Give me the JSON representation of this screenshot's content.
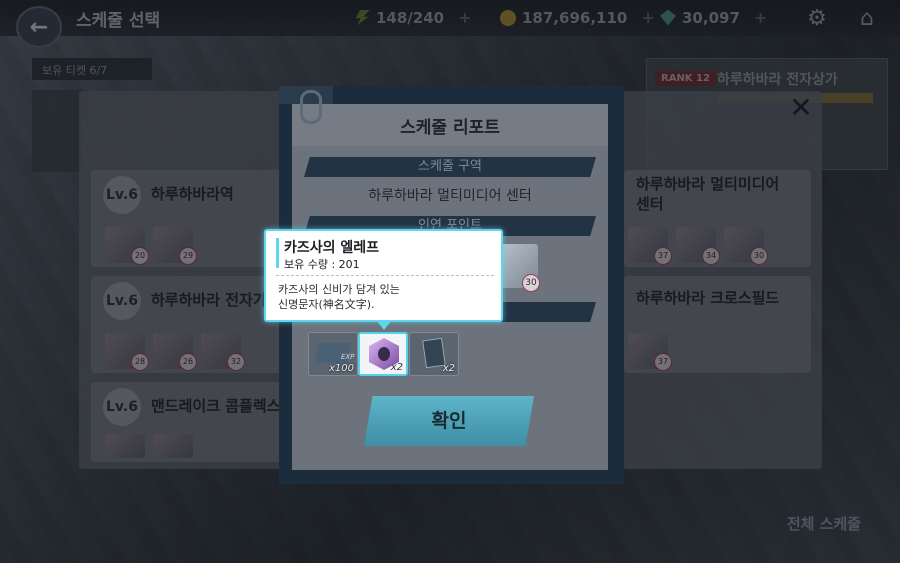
{
  "topbar": {
    "title": "스케줄 선택",
    "ap": "148/240",
    "gold": "187,696,110",
    "gems": "30,097"
  },
  "background": {
    "ticket_info": "보유 티켓 6/7",
    "rank_badge": "RANK 12",
    "rank_location": "하루하바라 전자상가",
    "locations_left": [
      {
        "lv": "Lv.6",
        "name": "하루하바라역",
        "char_levels": [
          "20",
          "29"
        ]
      },
      {
        "lv": "Lv.6",
        "name": "하루하바라 전자가",
        "char_levels": [
          "28",
          "26",
          "32"
        ]
      },
      {
        "lv": "Lv.6",
        "name": "맨드레이크 콤플렉스",
        "char_levels": []
      }
    ],
    "locations_right": [
      {
        "name": "하루하바라 멀티미디어 센터",
        "char_levels": [
          "37",
          "34",
          "30"
        ]
      },
      {
        "name": "하루하바라 크로스필드",
        "char_levels": [
          "37"
        ]
      }
    ],
    "all_schedule_label": "전체 스케줄"
  },
  "report": {
    "title": "스케줄 리포트",
    "area_label": "스케줄 구역",
    "area_value": "하루하바라 멀티미디어 센터",
    "bond_label": "인연 포인트",
    "char_level": "30",
    "rewards": [
      {
        "icon": "exp-report-icon",
        "qty": "x100"
      },
      {
        "icon": "eleph-crystal-icon",
        "qty": "x2"
      },
      {
        "icon": "artifact-card-icon",
        "qty": "x2"
      }
    ],
    "confirm_label": "확인"
  },
  "tooltip": {
    "name": "카즈사의 엘레프",
    "count": "보유 수량 : 201",
    "desc_line1": "카즈사의 신비가 담겨 있는",
    "desc_line2": "신명문자(神名文字)."
  }
}
